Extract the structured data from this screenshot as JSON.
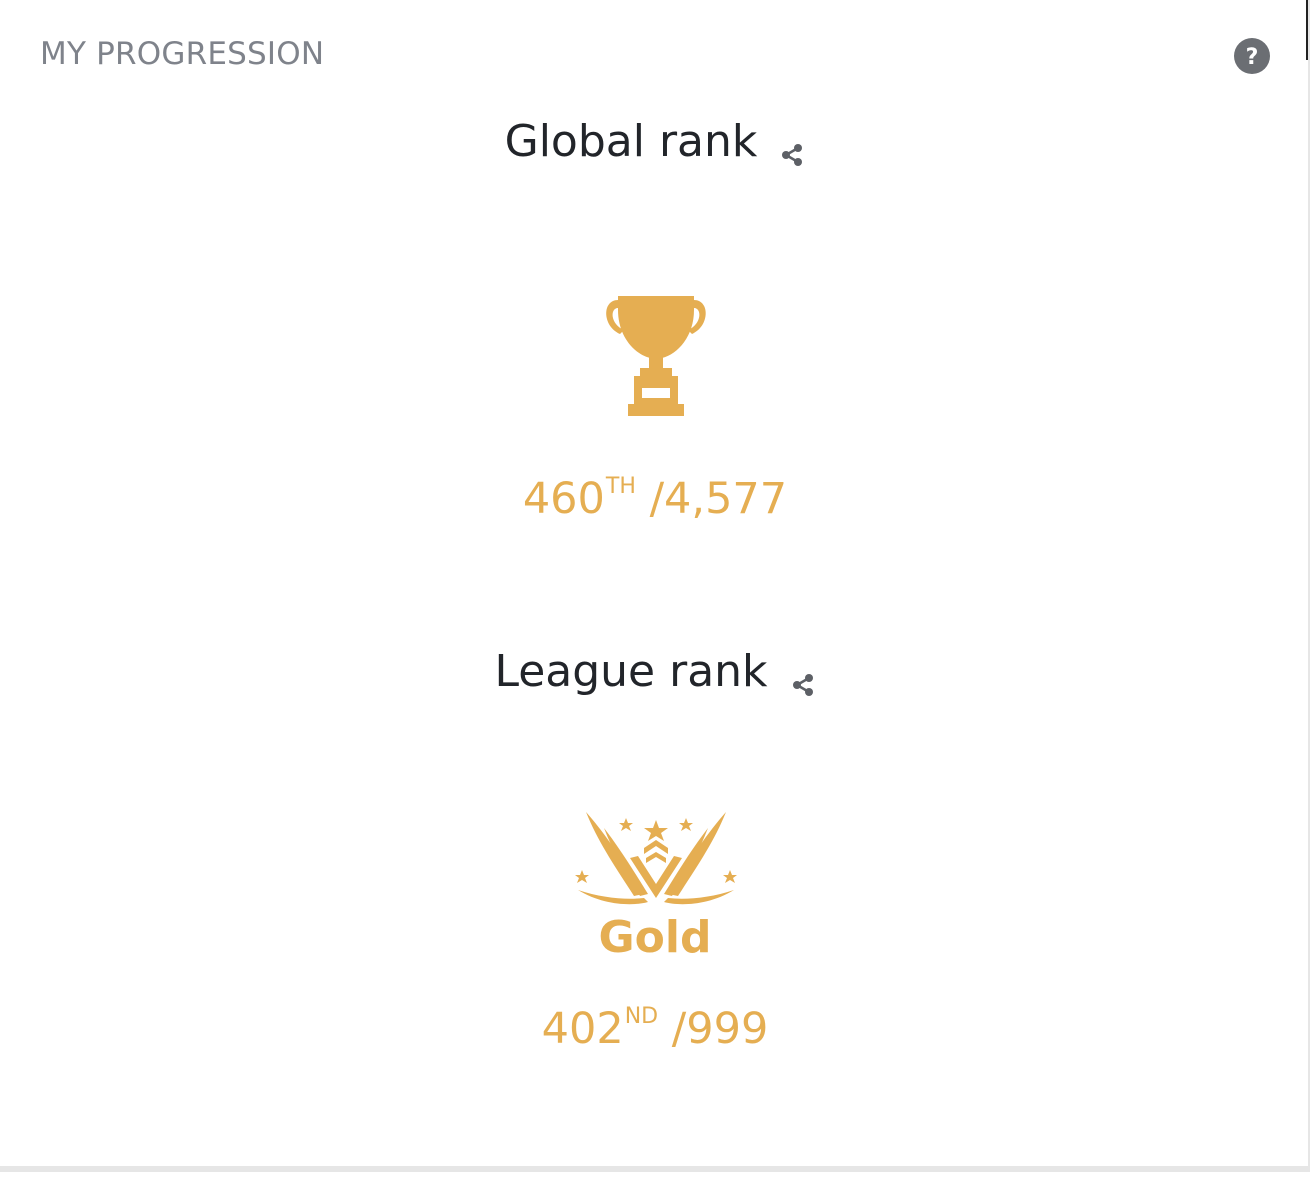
{
  "panel": {
    "title": "MY PROGRESSION",
    "help_icon": "question-circle-icon",
    "accent_color": "#e5ae52"
  },
  "global_rank": {
    "title": "Global rank",
    "share_icon": "share-icon",
    "icon": "trophy-icon",
    "position": "460",
    "suffix": "TH",
    "total": "/4,577"
  },
  "league_rank": {
    "title": "League rank",
    "share_icon": "share-icon",
    "icon": "gold-league-badge-icon",
    "league_name": "Gold",
    "position": "402",
    "suffix": "ND",
    "total": "/999"
  }
}
